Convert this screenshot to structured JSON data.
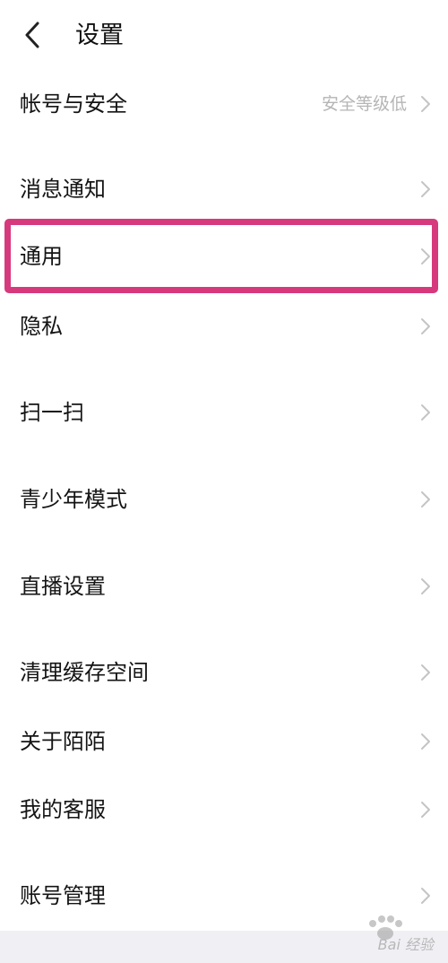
{
  "header": {
    "title": "设置",
    "back_icon": "chevron-left-icon"
  },
  "settings": {
    "items": [
      {
        "label": "帐号与安全",
        "value": "安全等级低"
      },
      {
        "label": "消息通知"
      },
      {
        "label": "通用",
        "highlighted": true
      },
      {
        "label": "隐私"
      },
      {
        "label": "扫一扫"
      },
      {
        "label": "青少年模式"
      },
      {
        "label": "直播设置"
      },
      {
        "label": "清理缓存空间"
      },
      {
        "label": "关于陌陌"
      },
      {
        "label": "我的客服"
      },
      {
        "label": "账号管理"
      }
    ]
  },
  "annotation": {
    "highlight_color": "#d63a7d"
  },
  "watermark": {
    "text": "Bai 经验"
  }
}
